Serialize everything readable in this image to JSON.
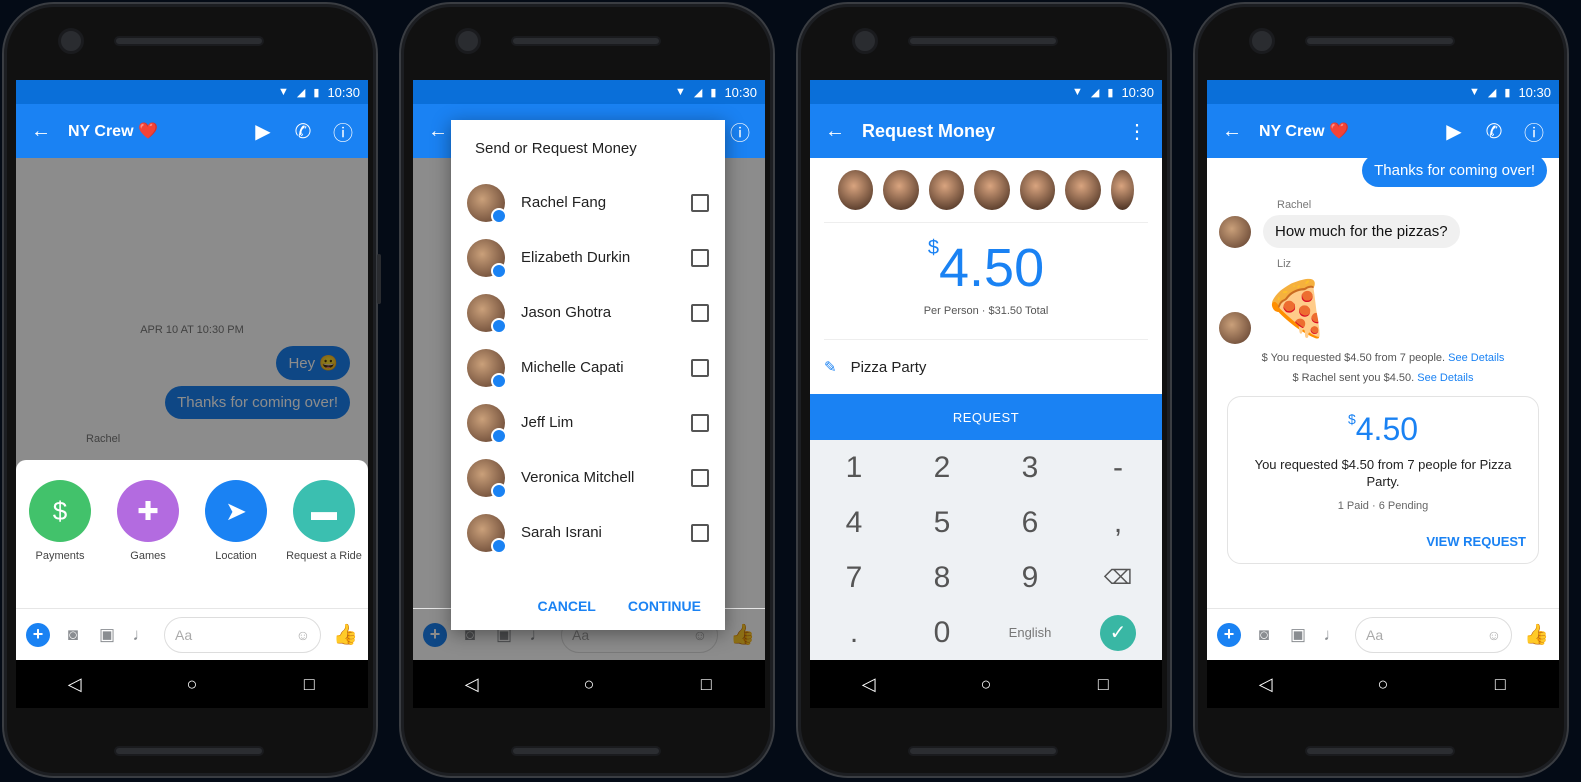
{
  "status": {
    "time": "10:30"
  },
  "screen1": {
    "title": "NY Crew ❤️",
    "date": "APR 10 AT 10:30 PM",
    "messages": [
      "Hey 😀",
      "Thanks for coming over!"
    ],
    "sender": "Rachel",
    "apps": [
      {
        "label": "Payments",
        "color": "#42c26b",
        "icon": "dollar-icon"
      },
      {
        "label": "Games",
        "color": "#b36be0",
        "icon": "gamepad-icon"
      },
      {
        "label": "Location",
        "color": "#1a82f3",
        "icon": "location-arrow-icon"
      },
      {
        "label": "Request a Ride",
        "color": "#3bbfb0",
        "icon": "car-icon"
      }
    ],
    "composer_placeholder": "Aa"
  },
  "screen2": {
    "dialog_title": "Send or Request Money",
    "contacts": [
      "Rachel Fang",
      "Elizabeth Durkin",
      "Jason Ghotra",
      "Michelle Capati",
      "Jeff Lim",
      "Veronica Mitchell",
      "Sarah Israni"
    ],
    "cancel": "CANCEL",
    "continue": "CONTINUE"
  },
  "screen3": {
    "title": "Request Money",
    "currency": "$",
    "amount": "4.50",
    "per_person": "Per Person · $31.50 Total",
    "memo": "Pizza Party",
    "request": "REQUEST",
    "keys": [
      "1",
      "2",
      "3",
      "-",
      "4",
      "5",
      "6",
      ",",
      "7",
      "8",
      "9",
      "⌫",
      ".",
      "0",
      "English",
      "✓"
    ]
  },
  "screen4": {
    "title": "NY Crew ❤️",
    "out_message": "Thanks for coming over!",
    "sender1": "Rachel",
    "in_message": "How much for the pizzas?",
    "sender2": "Liz",
    "sys1": "You requested $4.50 from 7 people.",
    "sys2": "Rachel sent you $4.50.",
    "see_details": "See Details",
    "card_currency": "$",
    "card_amount": "4.50",
    "card_desc": "You requested $4.50 from 7 people for Pizza Party.",
    "card_status": "1 Paid · 6 Pending",
    "view_request": "VIEW REQUEST"
  }
}
